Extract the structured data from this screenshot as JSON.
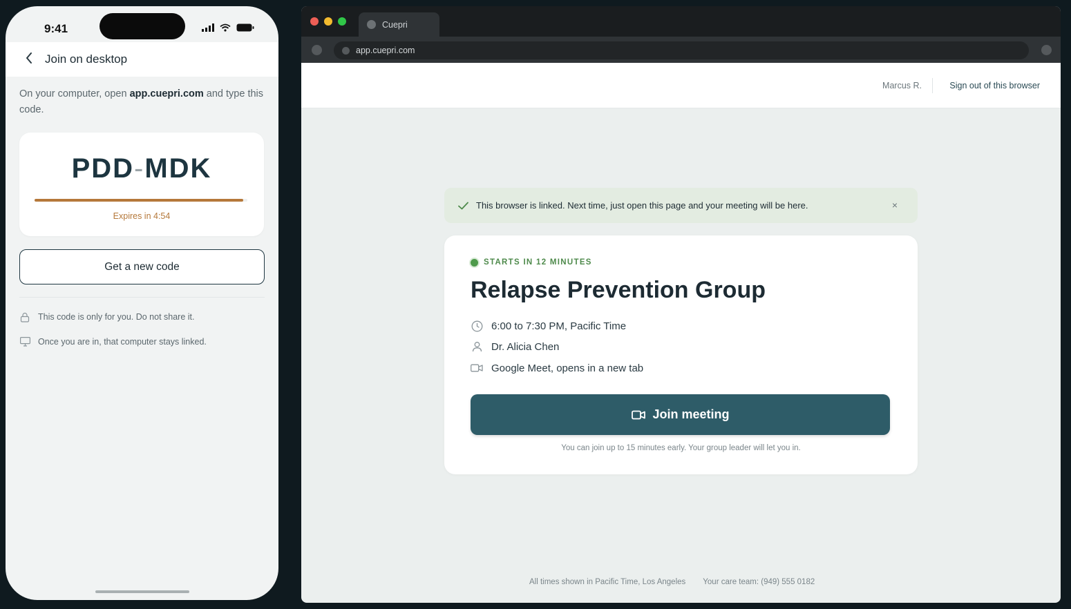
{
  "phone": {
    "status": {
      "time": "9:41"
    },
    "nav": {
      "title": "Join on desktop"
    },
    "instructions": {
      "prefix": "On your computer, open ",
      "domain": "app.cuepri.com",
      "suffix": " and type this code."
    },
    "code": {
      "part1": "PDD",
      "dash": "-",
      "part2": "MDK",
      "expires": "Expires in 4:54",
      "progress": 0.98
    },
    "new_code_button": "Get a new code",
    "notes": [
      {
        "icon": "lock-icon",
        "text": "This code is only for you. Do not share it."
      },
      {
        "icon": "monitor-icon",
        "text": "Once you are in, that computer stays linked."
      }
    ]
  },
  "browser": {
    "tab_title": "Cuepri",
    "url": "app.cuepri.com",
    "header": {
      "user_name": "Marcus R.",
      "sign_out": "Sign out of this browser"
    },
    "banner": {
      "text": "This browser is linked. Next time, just open this page and your meeting will be here.",
      "close": "×"
    },
    "meeting": {
      "status": "STARTS IN 12 MINUTES",
      "title": "Relapse Prevention Group",
      "time": "6:00 to 7:30 PM, Pacific Time",
      "host": "Dr. Alicia Chen",
      "location": "Google Meet, opens in a new tab",
      "join_label": "Join meeting",
      "join_note": "You can join up to 15 minutes early. Your group leader will let you in."
    },
    "footer": {
      "timezone": "All times shown in Pacific Time, Los Angeles",
      "care_team": "Your care team: (949) 555 0182"
    }
  },
  "colors": {
    "accent": "#2e5c68",
    "warning": "#b5783a",
    "success": "#4e9a4b",
    "banner_bg": "#e3ece1"
  }
}
